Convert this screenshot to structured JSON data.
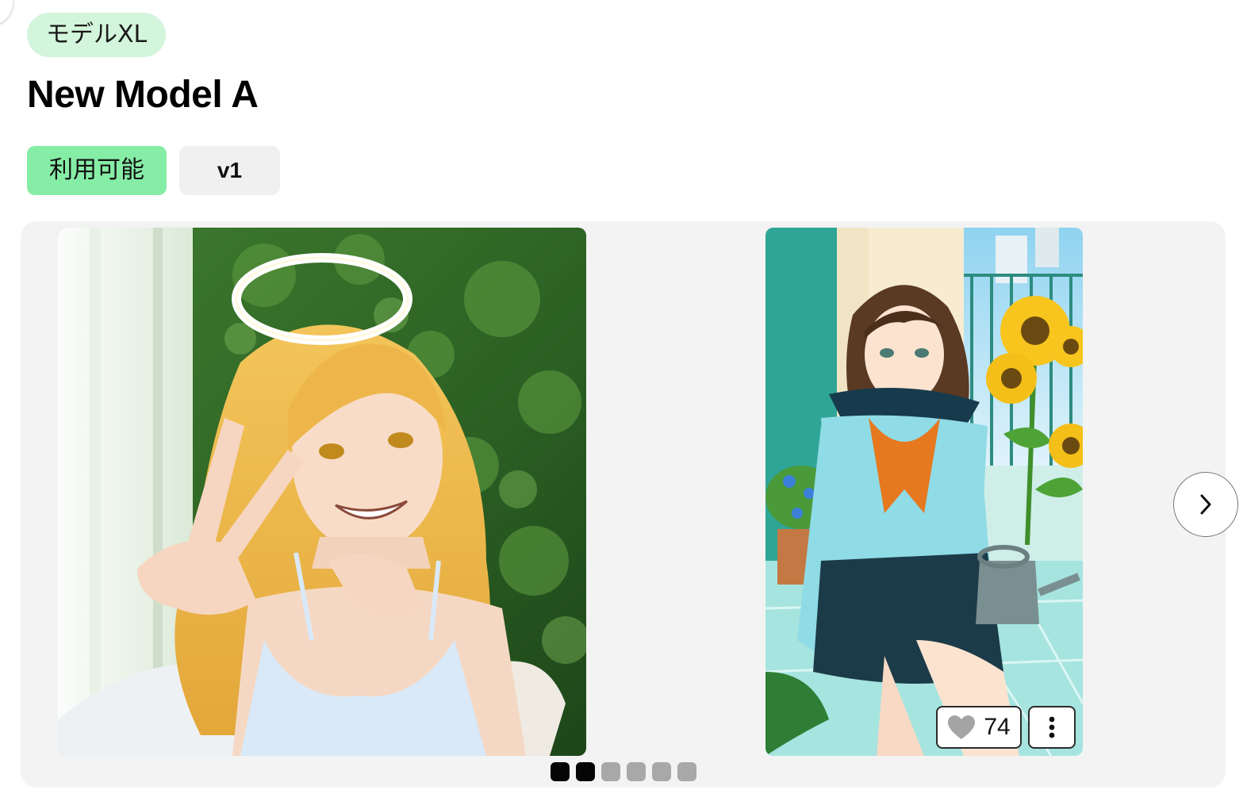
{
  "model": {
    "type_badge": "モデルXL",
    "title": "New Model A",
    "status": "利用可能",
    "version": "v1"
  },
  "carousel": {
    "slides": [
      {
        "icon": "angel-girl-image"
      },
      {
        "icon": "schoolgirl-sunflowers-image",
        "likes": "74"
      }
    ],
    "dots": {
      "total": 6,
      "active": [
        0,
        1
      ]
    }
  },
  "colors": {
    "type_badge_bg": "#d3f5dc",
    "status_bg": "#86eda6",
    "version_bg": "#f0f0f0",
    "carousel_bg": "#f3f3f3",
    "dot_active": "#050505",
    "dot_inactive": "#a8a8a8"
  }
}
